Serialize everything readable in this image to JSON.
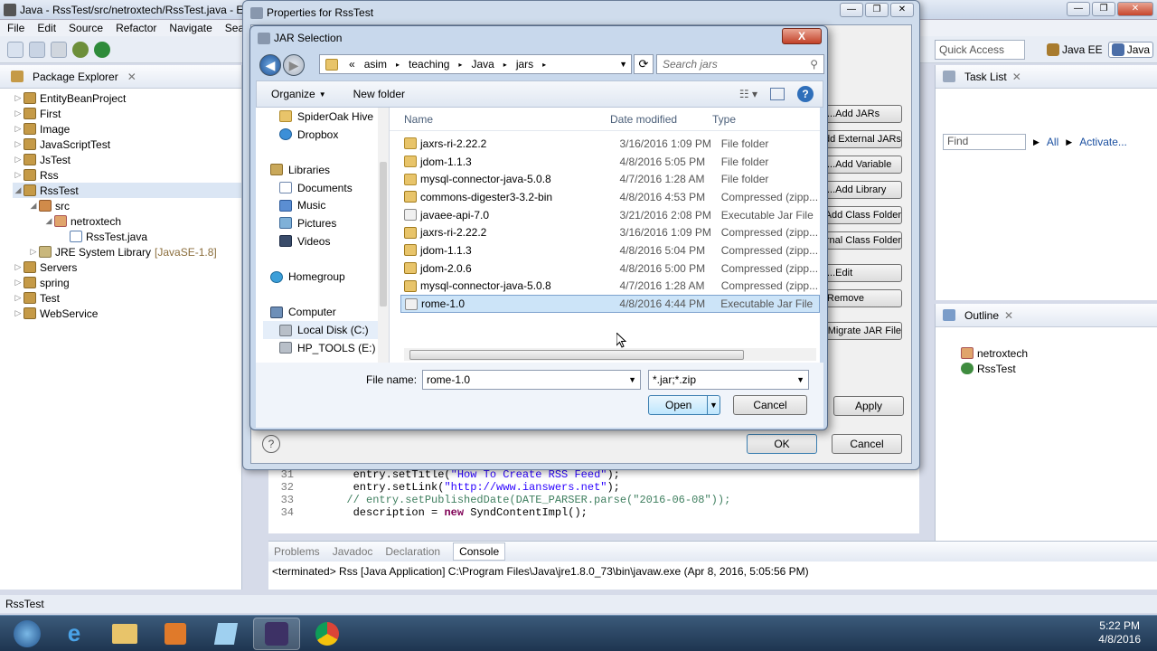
{
  "eclipse": {
    "title": "Java - RssTest/src/netroxtech/RssTest.java - Eclips",
    "menu": [
      "File",
      "Edit",
      "Source",
      "Refactor",
      "Navigate",
      "Search"
    ],
    "quick_access": "Quick Access",
    "perspectives": [
      "Java EE",
      "Java"
    ],
    "status_text": "RssTest"
  },
  "package_explorer": {
    "tab": "Package Explorer",
    "items": [
      {
        "label": "EntityBeanProject",
        "level": 0,
        "icon": "project-icon"
      },
      {
        "label": "First",
        "level": 0,
        "icon": "project-icon"
      },
      {
        "label": "Image",
        "level": 0,
        "icon": "project-icon"
      },
      {
        "label": "JavaScriptTest",
        "level": 0,
        "icon": "project-icon"
      },
      {
        "label": "JsTest",
        "level": 0,
        "icon": "project-icon"
      },
      {
        "label": "Rss",
        "level": 0,
        "icon": "project-icon"
      },
      {
        "label": "RssTest",
        "level": 0,
        "icon": "project-icon"
      },
      {
        "label": "src",
        "level": 1,
        "icon": "source-folder-icon"
      },
      {
        "label": "netroxtech",
        "level": 2,
        "icon": "package-icon"
      },
      {
        "label": "RssTest.java",
        "level": 3,
        "icon": "java-file-icon"
      },
      {
        "label": "JRE System Library",
        "suffix": "[JavaSE-1.8]",
        "level": 1,
        "icon": "library-icon"
      },
      {
        "label": "Servers",
        "level": 0,
        "icon": "project-icon"
      },
      {
        "label": "spring",
        "level": 0,
        "icon": "project-icon"
      },
      {
        "label": "Test",
        "level": 0,
        "icon": "project-icon"
      },
      {
        "label": "WebService",
        "level": 0,
        "icon": "project-icon"
      }
    ]
  },
  "task_list": {
    "tab": "Task List",
    "find_placeholder": "Find",
    "all": "All",
    "activate": "Activate..."
  },
  "outline": {
    "tab": "Outline",
    "items": [
      "netroxtech",
      "RssTest"
    ]
  },
  "editor": {
    "lines": [
      {
        "num": "31",
        "pre": "        entry.setTitle(",
        "str": "\"How To Create RSS Feed\"",
        "post": ");"
      },
      {
        "num": "32",
        "pre": "        entry.setLink(",
        "str": "\"http://www.ianswers.net\"",
        "post": ");"
      },
      {
        "num": "33",
        "comment": "       // entry.setPublishedDate(DATE_PARSER.parse(\"2016-06-08\"));"
      },
      {
        "num": "34",
        "pre": "        description = ",
        "kw": "new",
        "post": " SyndContentImpl();"
      }
    ]
  },
  "console": {
    "tabs": [
      "Problems",
      "Javadoc",
      "Declaration",
      "Console"
    ],
    "text": "<terminated> Rss [Java Application] C:\\Program Files\\Java\\jre1.8.0_73\\bin\\javaw.exe (Apr 8, 2016, 5:05:56 PM)"
  },
  "properties_dialog": {
    "title": "Properties for RssTest",
    "side_buttons": [
      "Add JARs...",
      "Add External JARs...",
      "Add Variable...",
      "Add Library...",
      "Add Class Folder...",
      "Add External Class Folder...",
      "Edit...",
      "Remove",
      "Migrate JAR File..."
    ],
    "apply": "Apply",
    "ok": "OK",
    "cancel": "Cancel"
  },
  "jar_dialog": {
    "title": "JAR Selection",
    "close": "X",
    "breadcrumb": [
      "«",
      "asim",
      "teaching",
      "Java",
      "jars"
    ],
    "search_placeholder": "Search jars",
    "organize": "Organize",
    "new_folder": "New folder",
    "nav_items": [
      {
        "label": "SpiderOak Hive",
        "icon": "folder-icon",
        "indent": 1
      },
      {
        "label": "Dropbox",
        "icon": "dropbox-icon",
        "indent": 1
      },
      {
        "label": "",
        "icon": "",
        "indent": 0
      },
      {
        "label": "Libraries",
        "icon": "libraries-icon",
        "indent": 0
      },
      {
        "label": "Documents",
        "icon": "documents-icon",
        "indent": 1
      },
      {
        "label": "Music",
        "icon": "music-icon",
        "indent": 1
      },
      {
        "label": "Pictures",
        "icon": "pictures-icon",
        "indent": 1
      },
      {
        "label": "Videos",
        "icon": "videos-icon",
        "indent": 1
      },
      {
        "label": "",
        "icon": "",
        "indent": 0
      },
      {
        "label": "Homegroup",
        "icon": "homegroup-icon",
        "indent": 0
      },
      {
        "label": "",
        "icon": "",
        "indent": 0
      },
      {
        "label": "Computer",
        "icon": "computer-icon",
        "indent": 0
      },
      {
        "label": "Local Disk (C:)",
        "icon": "disk-icon",
        "indent": 1
      },
      {
        "label": "HP_TOOLS (E:)",
        "icon": "disk-icon",
        "indent": 1
      }
    ],
    "columns": [
      "Name",
      "Date modified",
      "Type"
    ],
    "files": [
      {
        "name": "jaxrs-ri-2.22.2",
        "date": "3/16/2016 1:09 PM",
        "type": "File folder",
        "icon": "folder-icon"
      },
      {
        "name": "jdom-1.1.3",
        "date": "4/8/2016 5:05 PM",
        "type": "File folder",
        "icon": "folder-icon"
      },
      {
        "name": "mysql-connector-java-5.0.8",
        "date": "4/7/2016 1:28 AM",
        "type": "File folder",
        "icon": "folder-icon"
      },
      {
        "name": "commons-digester3-3.2-bin",
        "date": "4/8/2016 4:53 PM",
        "type": "Compressed (zipp...",
        "icon": "zip-icon"
      },
      {
        "name": "javaee-api-7.0",
        "date": "3/21/2016 2:08 PM",
        "type": "Executable Jar File",
        "icon": "jar-icon"
      },
      {
        "name": "jaxrs-ri-2.22.2",
        "date": "3/16/2016 1:09 PM",
        "type": "Compressed (zipp...",
        "icon": "zip-icon"
      },
      {
        "name": "jdom-1.1.3",
        "date": "4/8/2016 5:04 PM",
        "type": "Compressed (zipp...",
        "icon": "zip-icon"
      },
      {
        "name": "jdom-2.0.6",
        "date": "4/8/2016 5:00 PM",
        "type": "Compressed (zipp...",
        "icon": "zip-icon"
      },
      {
        "name": "mysql-connector-java-5.0.8",
        "date": "4/7/2016 1:28 AM",
        "type": "Compressed (zipp...",
        "icon": "zip-icon"
      },
      {
        "name": "rome-1.0",
        "date": "4/8/2016 4:44 PM",
        "type": "Executable Jar File",
        "icon": "jar-icon",
        "selected": true
      }
    ],
    "file_name_label": "File name:",
    "file_name_value": "rome-1.0",
    "filter_value": "*.jar;*.zip",
    "open": "Open",
    "cancel": "Cancel"
  },
  "taskbar": {
    "time": "5:22 PM",
    "date": "4/8/2016"
  }
}
